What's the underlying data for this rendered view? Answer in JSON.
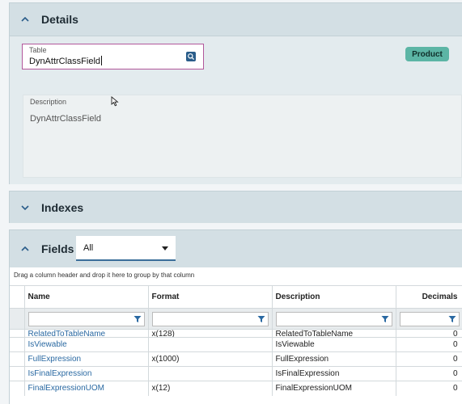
{
  "details": {
    "title": "Details",
    "table_label": "Table",
    "table_value": "DynAttrClassField",
    "product_label": "Product",
    "description_label": "Description",
    "description_value": "DynAttrClassField"
  },
  "indexes": {
    "title": "Indexes"
  },
  "fields": {
    "title": "Fields",
    "filter_value": "All",
    "group_hint": "Drag a column header and drop it here to group by that column",
    "columns": [
      "Name",
      "Format",
      "Description",
      "Decimals"
    ],
    "rows": [
      {
        "name": "RelatedToTableName",
        "format": "x(128)",
        "description": "RelatedToTableName",
        "decimals": "0"
      },
      {
        "name": "IsViewable",
        "format": "",
        "description": "IsViewable",
        "decimals": "0"
      },
      {
        "name": "FullExpression",
        "format": "x(1000)",
        "description": "FullExpression",
        "decimals": "0"
      },
      {
        "name": "IsFinalExpression",
        "format": "",
        "description": "IsFinalExpression",
        "decimals": "0"
      },
      {
        "name": "FinalExpressionUOM",
        "format": "x(12)",
        "description": "FinalExpressionUOM",
        "decimals": "0"
      }
    ]
  },
  "colors": {
    "accent": "#5cb5a5",
    "focus_border": "#b2579b",
    "link": "#2a69a2",
    "panel_header": "#d3dfe4"
  },
  "icons": {
    "collapse": "chevron-up-icon",
    "expand": "chevron-down-icon",
    "lookup": "search-icon",
    "filter": "filter-icon"
  }
}
